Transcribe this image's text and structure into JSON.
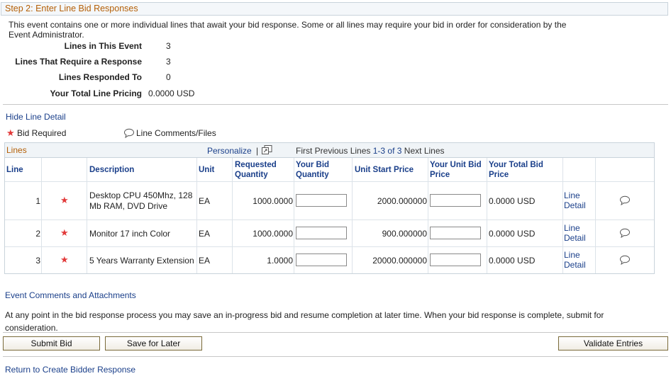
{
  "section_title": "Step 2: Enter Line Bid Responses",
  "intro_text": "This event contains one or more individual lines that await your bid response. Some or all lines may require your bid in order for consideration by the Event Administrator.",
  "summary": [
    {
      "label": "Lines in This Event",
      "value": "3"
    },
    {
      "label": "Lines That Require a Response",
      "value": "3"
    },
    {
      "label": "Lines Responded To",
      "value": "0"
    },
    {
      "label": "Your Total Line Pricing",
      "value": "0.0000 USD"
    }
  ],
  "hide_line_detail": "Hide Line Detail",
  "legend": {
    "bid_required": "Bid Required",
    "line_comments": "Line Comments/Files"
  },
  "grid": {
    "title": "Lines",
    "personalize": "Personalize",
    "nav_first": "First",
    "nav_previous": "Previous",
    "nav_lines": "Lines",
    "nav_range": "1-3 of 3",
    "nav_next": "Next",
    "nav_lines_after": "Lines",
    "headers": {
      "line": "Line",
      "description": "Description",
      "unit": "Unit",
      "requested_quantity": "Requested Quantity",
      "your_bid_quantity": "Your Bid Quantity",
      "unit_start_price": "Unit Start Price",
      "your_unit_bid_price": "Your Unit Bid Price",
      "your_total_bid_price": "Your Total Bid Price"
    },
    "rows": [
      {
        "line": "1",
        "description": "Desktop CPU 450Mhz, 128 Mb RAM, DVD Drive",
        "unit": "EA",
        "requested_quantity": "1000.0000",
        "bid_quantity": "",
        "unit_start_price": "2000.000000",
        "unit_bid_price": "",
        "total_bid_price": "0.0000 USD",
        "detail": "Line Detail"
      },
      {
        "line": "2",
        "description": "Monitor  17 inch Color",
        "unit": "EA",
        "requested_quantity": "1000.0000",
        "bid_quantity": "",
        "unit_start_price": "900.000000",
        "unit_bid_price": "",
        "total_bid_price": "0.0000 USD",
        "detail": "Line Detail"
      },
      {
        "line": "3",
        "description": "5 Years Warranty Extension",
        "unit": "EA",
        "requested_quantity": "1.0000",
        "bid_quantity": "",
        "unit_start_price": "20000.000000",
        "unit_bid_price": "",
        "total_bid_price": "0.0000 USD",
        "detail": "Line Detail"
      }
    ]
  },
  "event_comments": "Event Comments and Attachments",
  "save_note": "At any point in the bid response process you may save an in-progress bid and resume completion at later time. When your bid response is complete, submit for consideration.",
  "buttons": {
    "submit": "Submit Bid",
    "save": "Save for Later",
    "validate": "Validate Entries"
  },
  "return_link": "Return to Create Bidder Response",
  "colors": {
    "section_title": "#b45f06",
    "link": "#1a3f8a",
    "star": "#e23a3a"
  }
}
